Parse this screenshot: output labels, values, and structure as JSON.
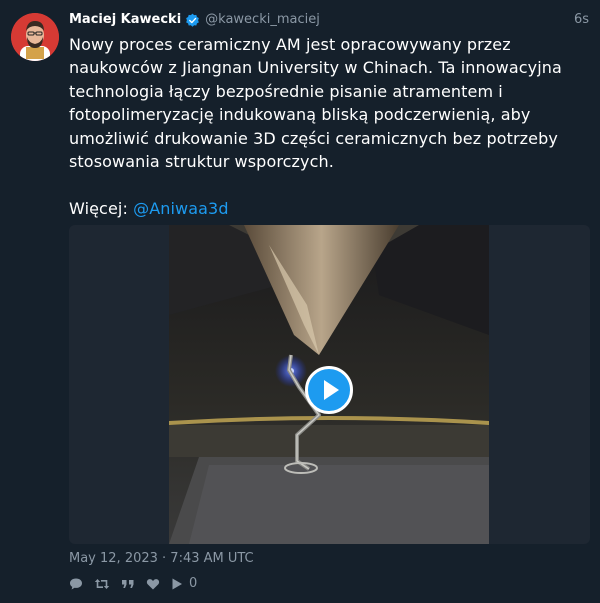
{
  "author": {
    "name": "Maciej Kawecki",
    "handle": "@kawecki_maciej",
    "time": "6s"
  },
  "tweet": {
    "text": "Nowy proces ceramiczny AM jest opracowywany przez naukowców z Jiangnan University w Chinach. Ta innowacyjna technologia łączy bezpośrednie pisanie atramentem i fotopolimeryzację indukowaną bliską podczerwienią, aby umożliwić drukowanie 3D części ceramicznych bez potrzeby stosowania struktur wsporczych.",
    "more_label": "Więcej:",
    "mention": "@Aniwaa3d",
    "date": "May 12, 2023 · 7:43 AM UTC"
  },
  "actions": {
    "play_count": "0"
  },
  "colors": {
    "background": "#15202b",
    "accent": "#1d9bf0",
    "muted": "#8b98a5",
    "text": "#ffffff"
  },
  "icons": [
    "verified-badge-icon",
    "play-icon",
    "reply-icon",
    "retweet-icon",
    "quote-icon",
    "like-icon",
    "views-icon"
  ]
}
